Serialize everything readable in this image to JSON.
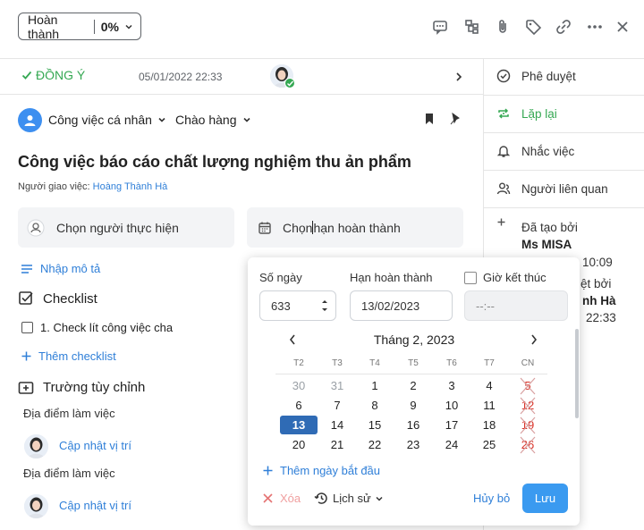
{
  "header": {
    "status_label": "Hoàn thành",
    "progress": "0%",
    "icons": [
      "comment-icon",
      "subtask-icon",
      "attach-icon",
      "tag-icon",
      "link-icon",
      "more-icon",
      "close-icon"
    ]
  },
  "approval": {
    "status": "ĐỒNG Ý",
    "date": "05/01/2022 22:33"
  },
  "task": {
    "type": "Công việc cá nhân",
    "stage": "Chào hàng",
    "title": "Công việc báo cáo chất lượng nghiệm thu ản phẩm",
    "assigner_label": "Người giao việc:",
    "assigner_name": "Hoàng Thành Hà",
    "assignee_placeholder": "Chọn người thực hiện",
    "due_placeholder_a": "Chọn",
    "due_placeholder_b": "hạn hoàn thành",
    "description_link": "Nhập mô tả"
  },
  "checklist": {
    "title": "Checklist",
    "items": [
      "1. Check lít công việc cha"
    ],
    "add_label": "Thêm checklist"
  },
  "custom_fields": {
    "title": "Trường tùy chỉnh",
    "items": [
      {
        "label": "Địa điểm làm việc",
        "action": "Cập nhật vị trí"
      },
      {
        "label": "Địa điểm làm việc",
        "action": "Cập nhật vị trí"
      }
    ]
  },
  "right_panel": {
    "items": [
      {
        "label": "Phê duyệt",
        "icon": "approve-icon"
      },
      {
        "label": "Lặp lại",
        "icon": "repeat-icon",
        "color": "#35a853"
      },
      {
        "label": "Nhắc việc",
        "icon": "bell-icon"
      },
      {
        "label": "Người liên quan",
        "icon": "people-icon"
      }
    ],
    "created_label": "Đã tạo bởi",
    "created_by": "Ms MISA",
    "created_time_partial": "10:09",
    "approved_label_partial": "ệt bởi",
    "approved_by_partial": "nh Hà",
    "approved_time_partial": "22:33"
  },
  "date_picker": {
    "days_label": "Số ngày",
    "days_value": "633",
    "deadline_label": "Hạn hoàn thành",
    "deadline_value": "13/02/2023",
    "end_time_label": "Giờ kết thúc",
    "end_time_value": "--:--",
    "month_title": "Tháng 2, 2023",
    "weekdays": [
      "T2",
      "T3",
      "T4",
      "T5",
      "T6",
      "T7",
      "CN"
    ],
    "weeks": [
      [
        "30",
        "31",
        "1",
        "2",
        "3",
        "4",
        "5"
      ],
      [
        "6",
        "7",
        "8",
        "9",
        "10",
        "11",
        "12"
      ],
      [
        "13",
        "14",
        "15",
        "16",
        "17",
        "18",
        "19"
      ],
      [
        "20",
        "21",
        "22",
        "23",
        "24",
        "25",
        "26"
      ]
    ],
    "selected": "13",
    "add_start_label": "Thêm ngày bắt đầu",
    "delete_label": "Xóa",
    "history_label": "Lịch sử",
    "cancel_label": "Hủy bỏ",
    "save_label": "Lưu"
  },
  "colors": {
    "accent": "#2f7fd8",
    "success": "#35a853",
    "primary_button": "#3a9af0",
    "selected_day": "#2f6bb5",
    "weekend": "#d93025"
  }
}
